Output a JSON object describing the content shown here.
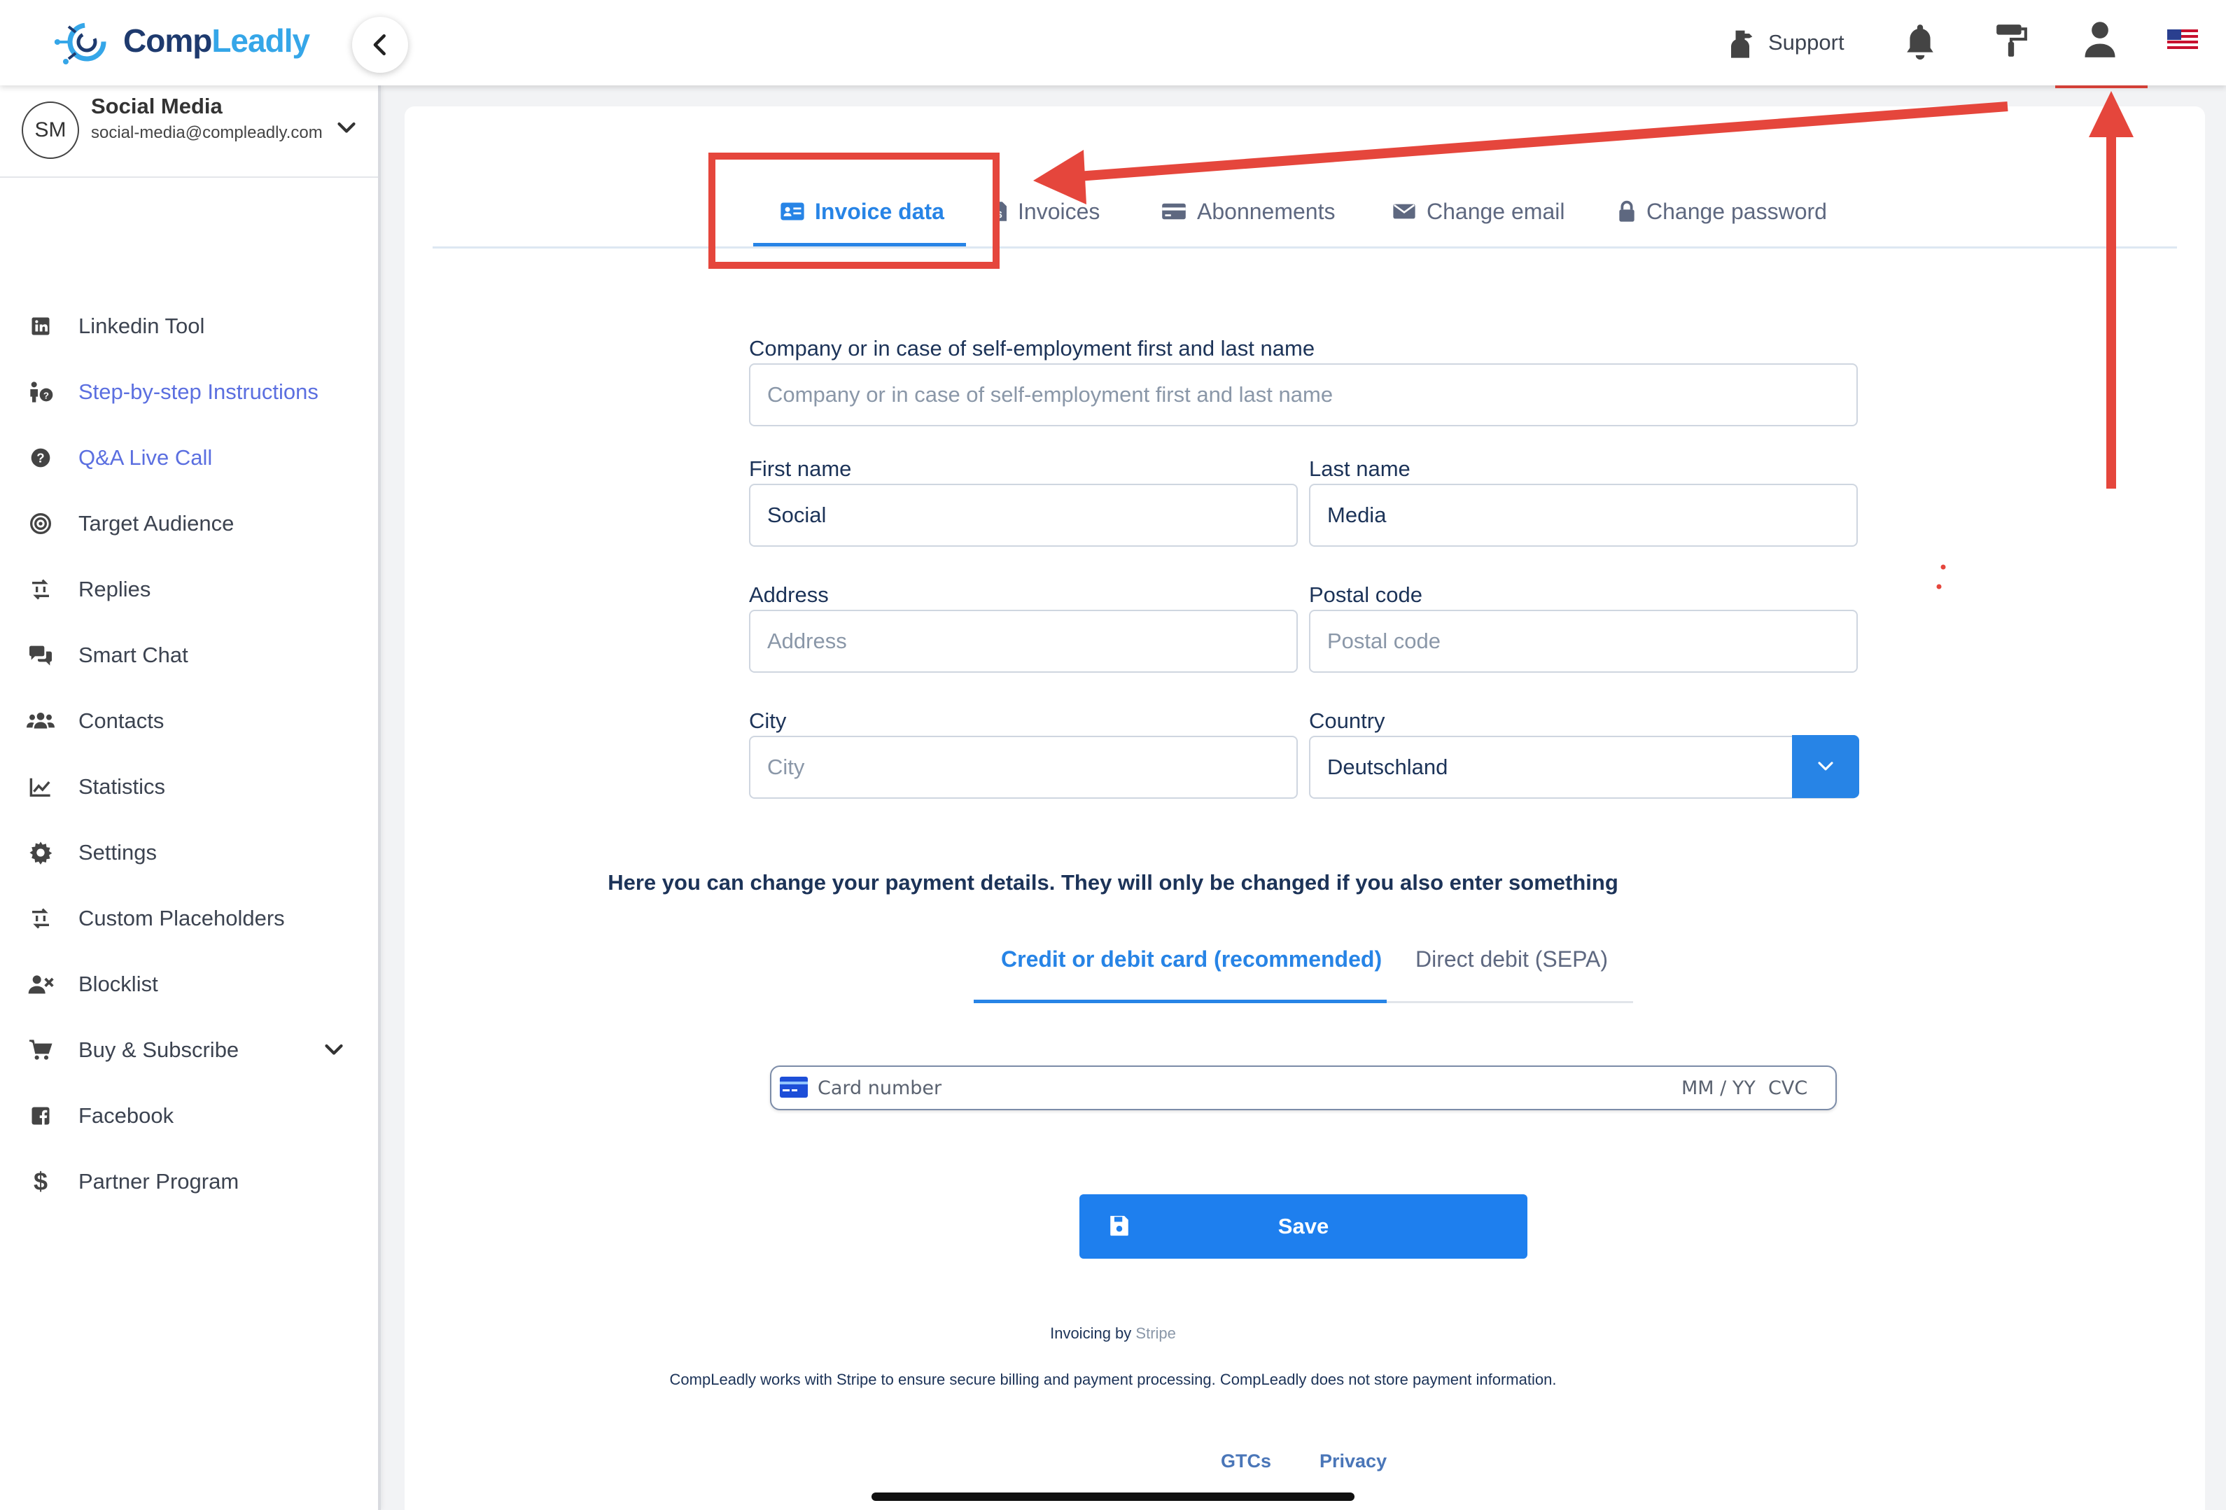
{
  "app": {
    "logo_text_1": "Comp",
    "logo_text_2": "Leadly"
  },
  "topbar": {
    "support_label": "Support",
    "icons": [
      "support-icon",
      "bell-icon",
      "paint-roller-icon",
      "user-icon",
      "us-flag-icon"
    ]
  },
  "user": {
    "initials": "SM",
    "name": "Social Media",
    "email": "social-media@compleadly.com"
  },
  "sidebar": {
    "items": [
      {
        "label": "Linkedin Tool",
        "icon": "linkedin-icon"
      },
      {
        "label": "Step-by-step Instructions",
        "icon": "instructions-icon",
        "highlight": true
      },
      {
        "label": "Q&A Live Call",
        "icon": "question-icon",
        "highlight": true
      },
      {
        "label": "Target Audience",
        "icon": "target-icon"
      },
      {
        "label": "Replies",
        "icon": "replies-icon"
      },
      {
        "label": "Smart Chat",
        "icon": "chat-icon"
      },
      {
        "label": "Contacts",
        "icon": "contacts-icon"
      },
      {
        "label": "Statistics",
        "icon": "chart-icon"
      },
      {
        "label": "Settings",
        "icon": "gear-icon"
      },
      {
        "label": "Custom Placeholders",
        "icon": "placeholders-icon"
      },
      {
        "label": "Blocklist",
        "icon": "blocklist-icon"
      },
      {
        "label": "Buy & Subscribe",
        "icon": "cart-icon"
      },
      {
        "label": "Facebook",
        "icon": "facebook-icon"
      },
      {
        "label": "Partner Program",
        "icon": "dollar-icon"
      }
    ]
  },
  "tabs": [
    {
      "label": "Invoice data",
      "active": true
    },
    {
      "label": "Invoices"
    },
    {
      "label": "Abonnements"
    },
    {
      "label": "Change email"
    },
    {
      "label": "Change password"
    }
  ],
  "form": {
    "company_label": "Company or in case of self-employment first and last name",
    "company_placeholder": "Company or in case of self-employment first and last name",
    "company_value": "",
    "first_name_label": "First name",
    "first_name_value": "Social",
    "last_name_label": "Last name",
    "last_name_value": "Media",
    "address_label": "Address",
    "address_placeholder": "Address",
    "postal_label": "Postal code",
    "postal_placeholder": "Postal code",
    "city_label": "City",
    "city_placeholder": "City",
    "country_label": "Country",
    "country_value": "Deutschland"
  },
  "payment": {
    "note": "Here you can change your payment details. They will only be changed if you also enter something",
    "tab_card": "Credit or debit card (recommended)",
    "tab_sepa": "Direct debit (SEPA)",
    "card_placeholder": "Card number",
    "expiry_placeholder": "MM / YY",
    "cvc_placeholder": "CVC"
  },
  "save_label": "Save",
  "footer": {
    "invoicing_prefix": "Invoicing by",
    "invoicing_provider": "Stripe",
    "disclaimer": "CompLeadly works with Stripe to ensure secure billing and payment processing. CompLeadly does not store payment information.",
    "gtcs": "GTCs",
    "privacy": "Privacy"
  },
  "colors": {
    "accent": "#2784e6",
    "annotation": "#e5463c",
    "brand_dark": "#1e3a6e",
    "brand_light": "#35a6e8"
  }
}
